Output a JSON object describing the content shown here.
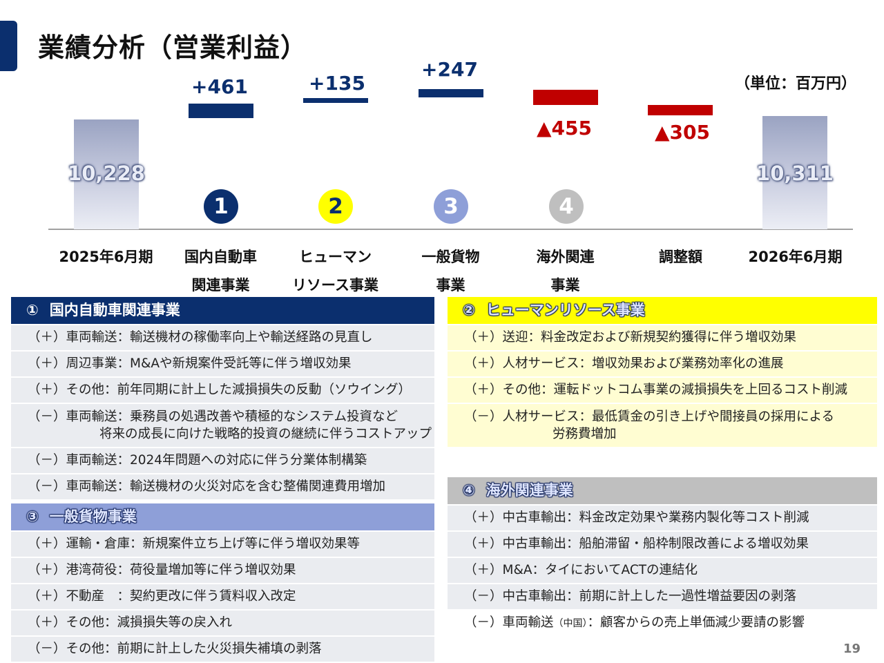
{
  "title": "業績分析（営業利益）",
  "unit": "（単位：百万円）",
  "chart_data": {
    "type": "waterfall",
    "unit": "百万円",
    "categories": [
      {
        "label": "2025年6月期",
        "kind": "total",
        "value": 10228,
        "display": "10,228",
        "color": "#b8bdd4"
      },
      {
        "label": "国内自動車\n関連事業",
        "kind": "delta",
        "value": 461,
        "display": "+461",
        "marker": "1",
        "marker_color": "#0b2f6e",
        "marker_text_color": "#ffffff"
      },
      {
        "label": "ヒューマン\nリソース事業",
        "kind": "delta",
        "value": 135,
        "display": "+135",
        "marker": "2",
        "marker_color": "#ffff00",
        "marker_text_color": "#0b2f6e"
      },
      {
        "label": "一般貨物\n事業",
        "kind": "delta",
        "value": 247,
        "display": "+247",
        "marker": "3",
        "marker_color": "#8e9fd8",
        "marker_text_color": "#ffffff"
      },
      {
        "label": "海外関連\n事業",
        "kind": "delta",
        "value": -455,
        "display": "▲455",
        "marker": "4",
        "marker_color": "#bfbfbf",
        "marker_text_color": "#ffffff"
      },
      {
        "label": "調整額",
        "kind": "delta",
        "value": -305,
        "display": "▲305"
      },
      {
        "label": "2026年6月期",
        "kind": "total",
        "value": 10311,
        "display": "10,311",
        "color": "#b8bdd4"
      }
    ],
    "positive_color": "#0b2f6e",
    "negative_color": "#c00000"
  },
  "sections": {
    "s1": {
      "num": "①",
      "title": "国内自動車関連事業",
      "color": "#0b2f6e",
      "rows": [
        [
          "（＋）車両輸送：輸送機材の稼働率向上や輸送経路の見直し"
        ],
        [
          "（＋）周辺事業：M&Aや新規案件受託等に伴う増収効果"
        ],
        [
          "（＋）その他：前年同期に計上した減損損失の反動（ソウイング）"
        ],
        [
          "（－）車両輸送：乗務員の処遇改善や積極的なシステム投資など",
          "将来の成長に向けた戦略的投資の継続に伴うコストアップ"
        ],
        [
          "（－）車両輸送：2024年問題への対応に伴う分業体制構築"
        ],
        [
          "（－）車両輸送：輸送機材の火災対応を含む整備関連費用増加"
        ]
      ]
    },
    "s2": {
      "num": "②",
      "title": "ヒューマンリソース事業",
      "color": "#ffff00",
      "rows": [
        [
          "（＋）送迎：料金改定および新規契約獲得に伴う増収効果"
        ],
        [
          "（＋）人材サービス：増収効果および業務効率化の進展"
        ],
        [
          "（＋）その他：運転ドットコム事業の減損損失を上回るコスト削減"
        ],
        [
          "（－）人材サービス：最低賃金の引き上げや間接員の採用による",
          "労務費増加"
        ]
      ]
    },
    "s3": {
      "num": "③",
      "title": "一般貨物事業",
      "color": "#8e9fd8",
      "rows": [
        [
          "（＋）運輸・倉庫：新規案件立ち上げ等に伴う増収効果等"
        ],
        [
          "（＋）港湾荷役：荷役量増加等に伴う増収効果"
        ],
        [
          "（＋）不動産　：契約更改に伴う賃料収入改定"
        ],
        [
          "（＋）その他：減損損失等の戻入れ"
        ],
        [
          "（－）その他：前期に計上した火災損失補填の剥落"
        ]
      ]
    },
    "s4": {
      "num": "④",
      "title": "海外関連事業",
      "color": "#bfbfbf",
      "rows": [
        [
          "（＋）中古車輸出：料金改定効果や業務内製化等コスト削減"
        ],
        [
          "（＋）中古車輸出：船舶滞留・船枠制限改善による増収効果"
        ],
        [
          "（＋）M&A：タイにおいてACTの連結化"
        ],
        [
          "（－）中古車輸出：前期に計上した一過性増益要因の剥落"
        ],
        [
          "（－）車両輸送",
          "（中国）",
          "：顧客からの売上単価減少要請の影響"
        ]
      ]
    }
  },
  "page_number": "19"
}
